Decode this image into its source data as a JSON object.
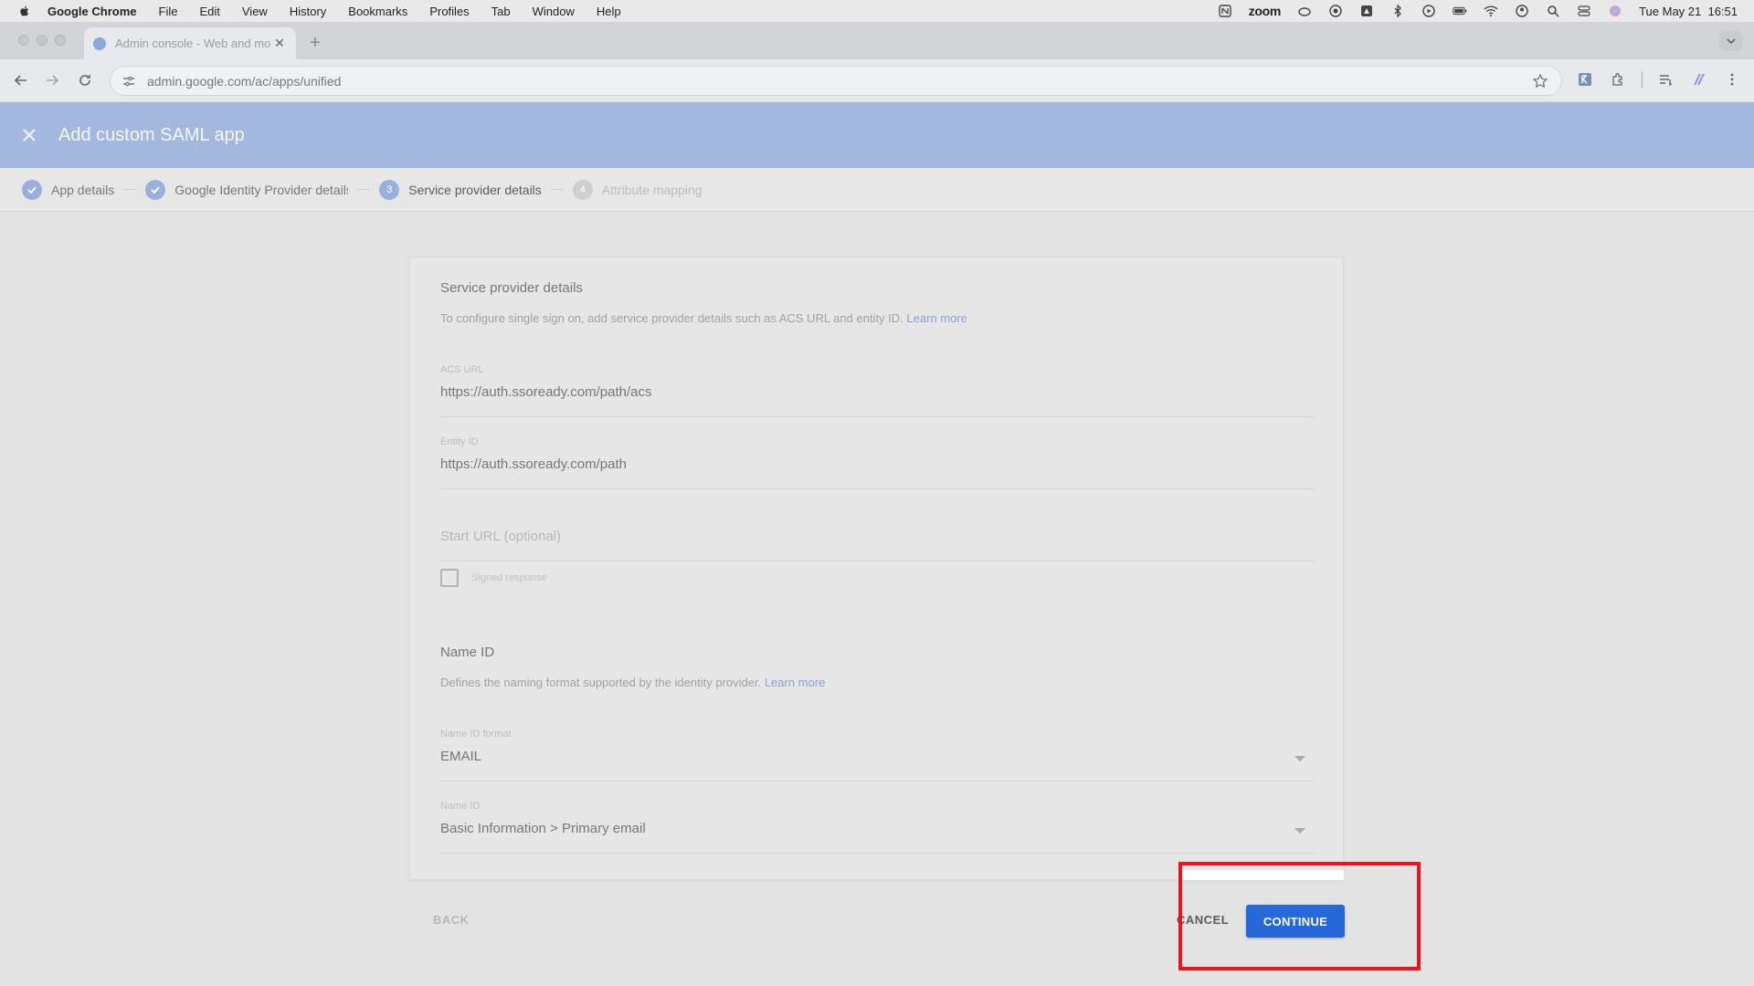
{
  "menubar": {
    "app_name": "Google Chrome",
    "items": [
      "File",
      "Edit",
      "View",
      "History",
      "Bookmarks",
      "Profiles",
      "Tab",
      "Window",
      "Help"
    ],
    "zoom_label": "zoom",
    "datetime": "Tue May 21  16:51"
  },
  "browser": {
    "tab_title": "Admin console - Web and mo",
    "url": "admin.google.com/ac/apps/unified"
  },
  "header": {
    "title": "Add custom SAML app"
  },
  "steps": [
    {
      "label": "App details",
      "state": "done"
    },
    {
      "label": "Google Identity Provider details",
      "state": "done"
    },
    {
      "number": "3",
      "label": "Service provider details",
      "state": "active"
    },
    {
      "number": "4",
      "label": "Attribute mapping",
      "state": "pending"
    }
  ],
  "service_provider": {
    "title": "Service provider details",
    "description": "To configure single sign on, add service provider details such as ACS URL and entity ID.",
    "learn_more": "Learn more",
    "acs_label": "ACS URL",
    "acs_value": "https://auth.ssoready.com/path/acs",
    "entity_label": "Entity ID",
    "entity_value": "https://auth.ssoready.com/path",
    "start_url_placeholder": "Start URL (optional)",
    "signed_response_label": "Signed response",
    "signed_response_checked": false
  },
  "name_id": {
    "title": "Name ID",
    "description": "Defines the naming format supported by the identity provider.",
    "learn_more": "Learn more",
    "format_label": "Name ID format",
    "format_value": "EMAIL",
    "nameid_label": "Name ID",
    "nameid_value": "Basic Information > Primary email"
  },
  "actions": {
    "back": "BACK",
    "cancel": "CANCEL",
    "continue": "CONTINUE"
  },
  "colors": {
    "header_bg": "#a4b7dd",
    "primary_button": "#2667d9",
    "highlight_box": "#e8131b"
  }
}
